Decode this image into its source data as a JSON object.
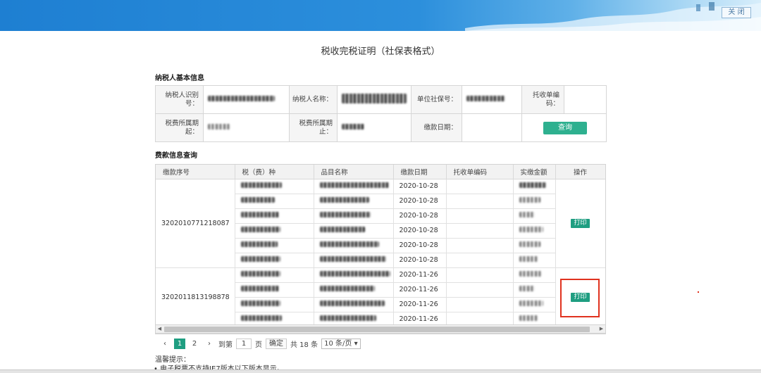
{
  "header": {
    "close_label": "关 闭"
  },
  "page_title": "税收完税证明（社保表格式）",
  "basic_info": {
    "section_title": "纳税人基本信息",
    "taxpayer_id_label": "纳税人识别号：",
    "taxpayer_name_label": "纳税人名称：",
    "unit_ss_no_label": "单位社保号：",
    "collection_no_label": "托收单编码：",
    "period_start_label": "税费所属期起：",
    "period_end_label": "税费所属期止：",
    "pay_date_label": "缴款日期：",
    "query_label": "查询"
  },
  "payment": {
    "section_title": "费款信息查询",
    "columns": [
      "缴款序号",
      "税（费）种",
      "品目名称",
      "缴款日期",
      "托收单编码",
      "实缴金额",
      "操作"
    ],
    "groups": [
      {
        "serial": "3202010771218087",
        "print_label": "打印",
        "rows": [
          {
            "date": "2020-10-28"
          },
          {
            "date": "2020-10-28"
          },
          {
            "date": "2020-10-28"
          },
          {
            "date": "2020-10-28"
          },
          {
            "date": "2020-10-28"
          },
          {
            "date": "2020-10-28"
          }
        ]
      },
      {
        "serial": "3202011813198878",
        "print_label": "打印",
        "rows": [
          {
            "date": "2020-11-26"
          },
          {
            "date": "2020-11-26"
          },
          {
            "date": "2020-11-26"
          },
          {
            "date": "2020-11-26"
          }
        ]
      }
    ]
  },
  "pager": {
    "prev": "‹",
    "page1": "1",
    "page2": "2",
    "next": "›",
    "goto_label": "到第",
    "goto_value": "1",
    "page_label": "页",
    "confirm_label": "确定",
    "total_label": "共 18 条",
    "page_size": "10 条/页"
  },
  "tips": {
    "title": "温馨提示：",
    "line1": "• 电子税票不支持IE7版本以下版本显示。"
  }
}
